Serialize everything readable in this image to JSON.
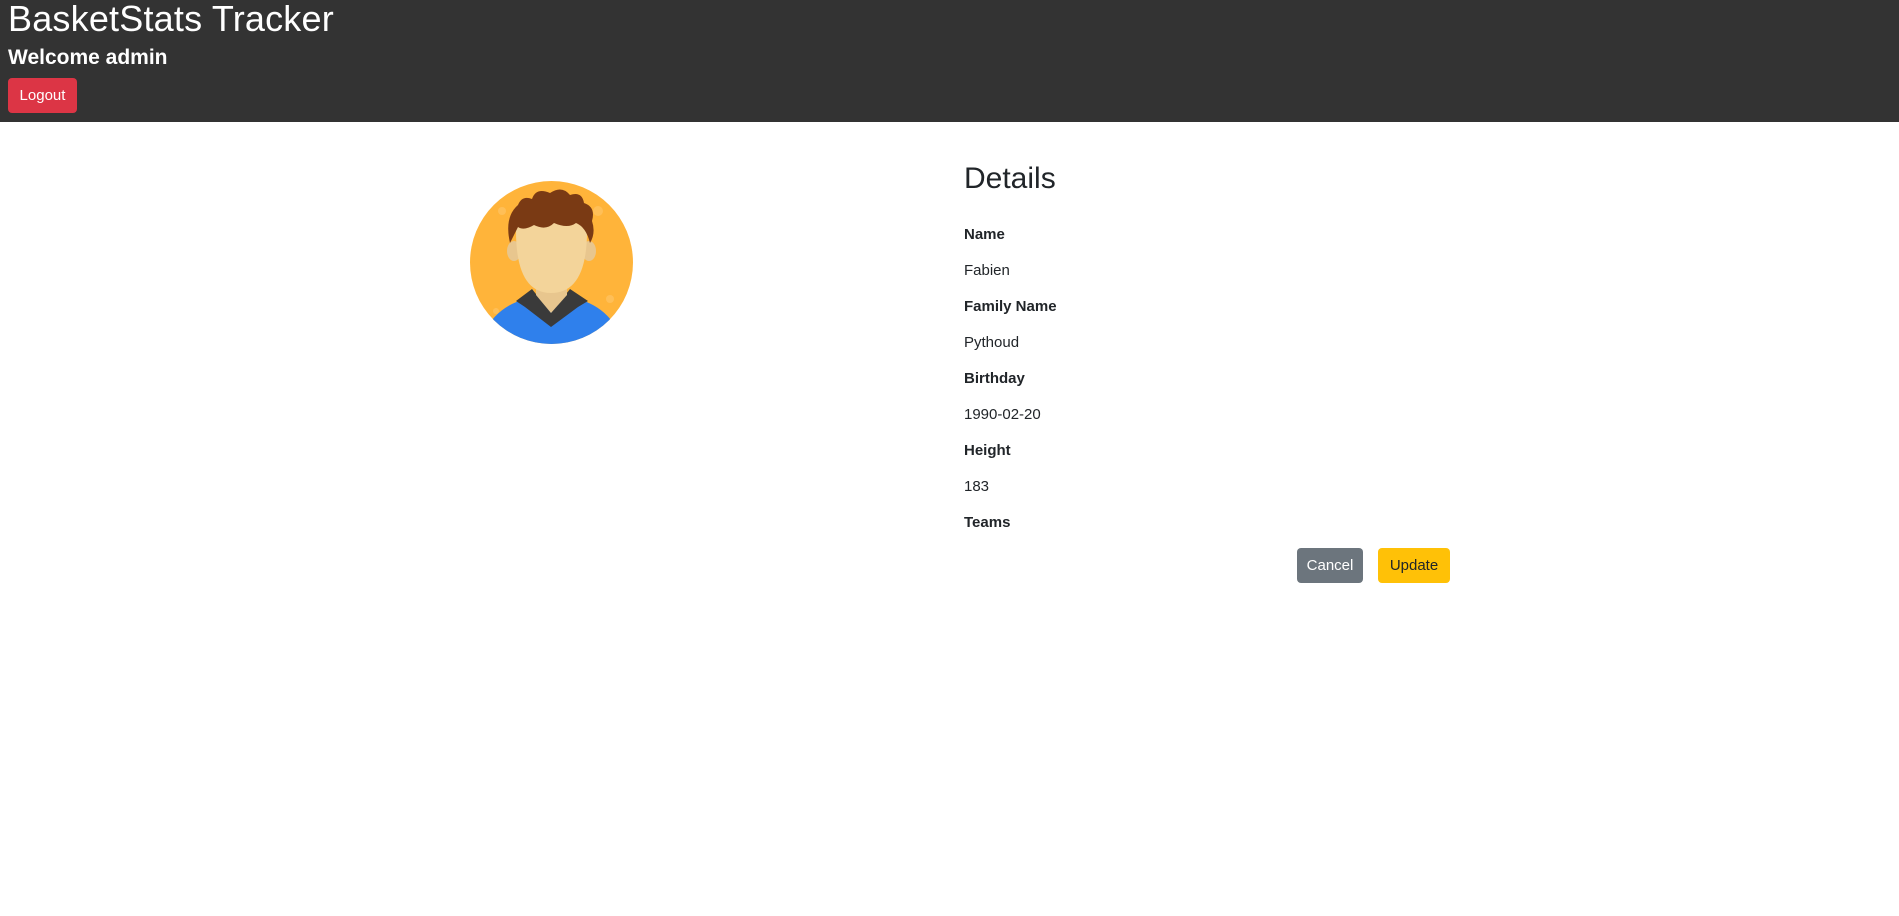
{
  "header": {
    "app_title": "BasketStats Tracker",
    "welcome": "Welcome admin",
    "logout_label": "Logout",
    "background": "#333333"
  },
  "avatar": {
    "icon": "person-avatar-icon"
  },
  "details": {
    "heading": "Details",
    "fields": [
      {
        "label": "Name",
        "value": "Fabien"
      },
      {
        "label": "Family Name",
        "value": "Pythoud"
      },
      {
        "label": "Birthday",
        "value": "1990-02-20"
      },
      {
        "label": "Height",
        "value": "183"
      },
      {
        "label": "Teams",
        "value": ""
      }
    ]
  },
  "actions": {
    "cancel_label": "Cancel",
    "update_label": "Update",
    "cancel_color": "#6c757d",
    "update_color": "#ffc107",
    "logout_color": "#dc3545"
  }
}
